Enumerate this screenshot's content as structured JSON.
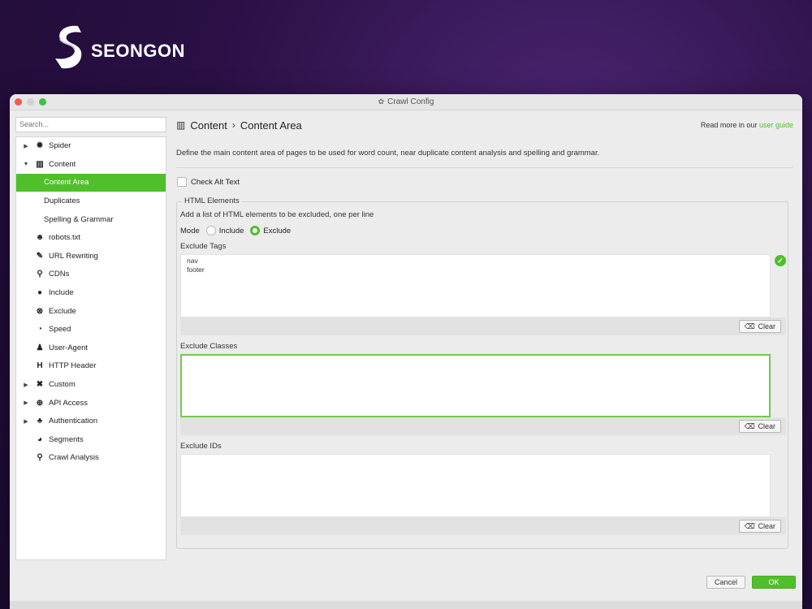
{
  "brand": {
    "name": "SEONGON"
  },
  "window": {
    "title": "Crawl Config"
  },
  "sidebar": {
    "search_placeholder": "Search...",
    "items": [
      {
        "label": "Spider",
        "arrow": "▶",
        "icon": "✹",
        "level": 0
      },
      {
        "label": "Content",
        "arrow": "▼",
        "icon": "▥",
        "level": 0
      },
      {
        "label": "Content Area",
        "level": 2,
        "active": true
      },
      {
        "label": "Duplicates",
        "level": 2
      },
      {
        "label": "Spelling & Grammar",
        "level": 2
      },
      {
        "label": "robots.txt",
        "icon": "☻",
        "level": 1
      },
      {
        "label": "URL Rewriting",
        "icon": "✎",
        "level": 1
      },
      {
        "label": "CDNs",
        "icon": "⚲",
        "level": 1
      },
      {
        "label": "Include",
        "icon": "●",
        "level": 1
      },
      {
        "label": "Exclude",
        "icon": "⊗",
        "level": 1
      },
      {
        "label": "Speed",
        "icon": "◔",
        "level": 1
      },
      {
        "label": "User-Agent",
        "icon": "♟",
        "level": 1
      },
      {
        "label": "HTTP Header",
        "icon": "H",
        "level": 1
      },
      {
        "label": "Custom",
        "arrow": "▶",
        "icon": "✖",
        "level": 0
      },
      {
        "label": "API Access",
        "arrow": "▶",
        "icon": "⊕",
        "level": 0
      },
      {
        "label": "Authentication",
        "arrow": "▶",
        "icon": "♣",
        "level": 0
      },
      {
        "label": "Segments",
        "icon": "◕",
        "level": 1
      },
      {
        "label": "Crawl Analysis",
        "icon": "⚲",
        "level": 1
      }
    ]
  },
  "content": {
    "crumb_root": "Content",
    "crumb_sep": "›",
    "crumb_page": "Content Area",
    "read_more_prefix": "Read more in our",
    "read_more_link": "user guide",
    "description": "Define the main content area of pages to be used for word count, near duplicate content analysis and spelling and grammar.",
    "check_alt_text": "Check Alt Text",
    "group": {
      "legend": "HTML Elements",
      "description": "Add a list of HTML elements to be excluded, one per line",
      "mode_label": "Mode",
      "mode_include": "Include",
      "mode_exclude": "Exclude",
      "mode_selected": "Exclude",
      "exclude_tags_label": "Exclude Tags",
      "exclude_tags_value": "nav\nfooter",
      "exclude_classes_label": "Exclude Classes",
      "exclude_classes_value": "",
      "exclude_ids_label": "Exclude IDs",
      "exclude_ids_value": "",
      "clear_label": "Clear"
    }
  },
  "footer": {
    "cancel": "Cancel",
    "ok": "OK"
  },
  "colors": {
    "accent": "#4fbf2a",
    "background": "#2a1045"
  }
}
